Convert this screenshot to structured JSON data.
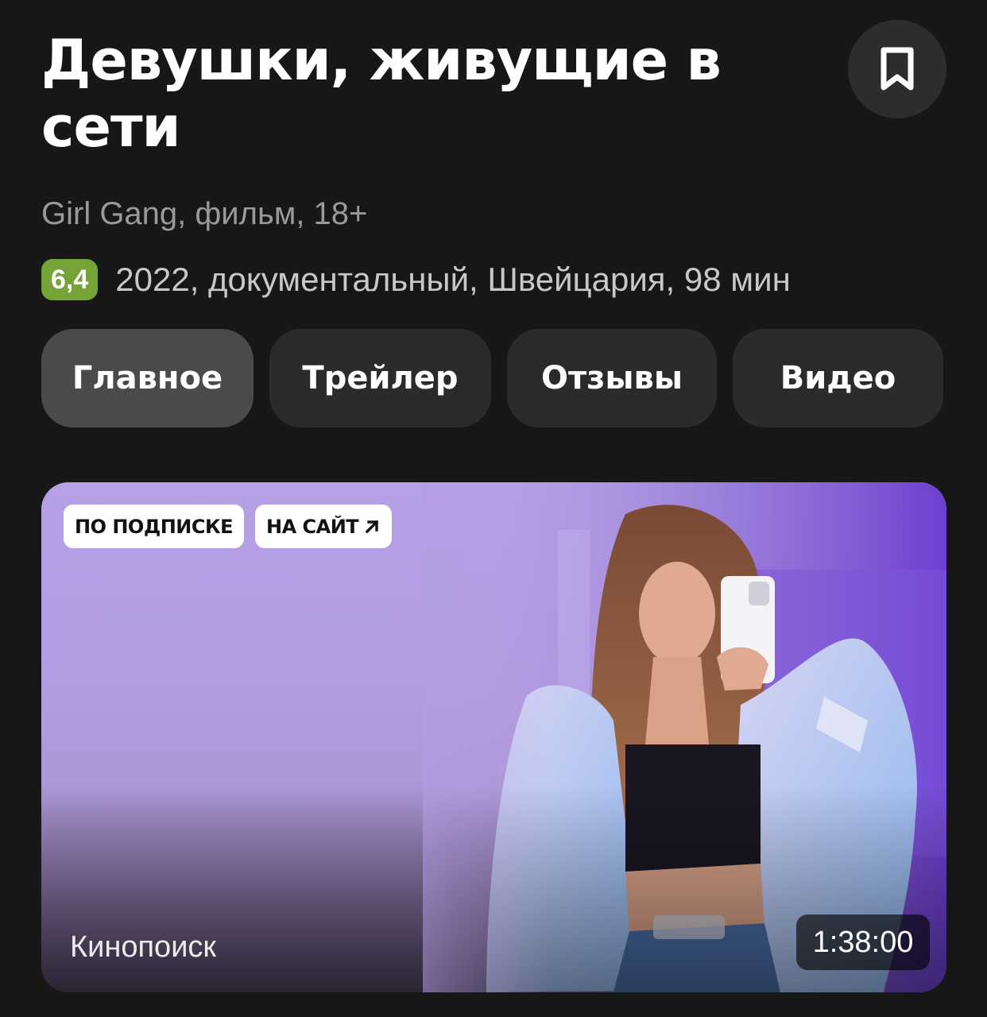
{
  "header": {
    "title": "Девушки, живущие в сети",
    "bookmark_icon": "bookmark-icon"
  },
  "info": {
    "subtitle": "Girl Gang, фильм, 18+",
    "rating": "6,4",
    "details": "2022, документальный, Швейцария, 98 мин"
  },
  "tabs": [
    {
      "label": "Главное",
      "active": true
    },
    {
      "label": "Трейлер",
      "active": false
    },
    {
      "label": "Отзывы",
      "active": false
    },
    {
      "label": "Видео",
      "active": false
    }
  ],
  "media": {
    "badge_subscription": "ПО ПОДПИСКЕ",
    "badge_site": "НА САЙТ",
    "badge_site_icon": "arrow-up-right-icon",
    "source": "Кинопоиск",
    "duration": "1:38:00"
  },
  "colors": {
    "background": "#171717",
    "rating_badge": "#75a338",
    "tab": "#2b2b2b",
    "tab_active": "#4a4a4a",
    "card_tint": "#b7a0e6"
  }
}
